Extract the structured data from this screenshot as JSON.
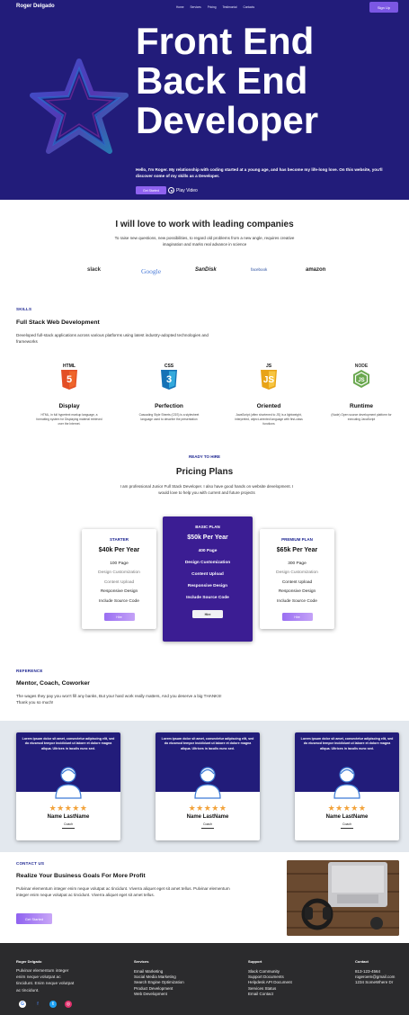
{
  "nav": {
    "brand": "Roger Delgado",
    "links": [
      "Home",
      "Services",
      "Pricing",
      "Testimonial",
      "Contacts"
    ],
    "signup": "Sign Up"
  },
  "hero": {
    "title_line1": "Front End",
    "title_line2": "Back End",
    "title_line3": "Developer",
    "description": "Hello, I'm Roger. My relationship with coding started at a young age, and has become my life-long love. On this website, you'll discover some of my skills as a Developer.",
    "cta": "Get Started",
    "play": "Play Video"
  },
  "companies": {
    "title": "I will love to work with leading companies",
    "description": "To raise new questions, new possibilities, to regard old problems from a new angle, requires creative imagination and marks real advance in science",
    "logos": [
      "slack",
      "Google",
      "SanDisk",
      "facebook",
      "amazon"
    ]
  },
  "skills": {
    "eyebrow": "SKILLS",
    "title": "Full Stack Web Development",
    "description": "Developed full-stack applications across various platforms using latest industry-adopted technologies and frameworks",
    "items": [
      {
        "name": "Display",
        "badge": "HTML",
        "desc": "HTML, in full hypertext markup language, a formatting system for Displaying material retrieved over the Internet."
      },
      {
        "name": "Perfection",
        "badge": "CSS",
        "desc": "Cascading Style Sheets (CSS) is a stylesheet language used to describe the presentation"
      },
      {
        "name": "Oriented",
        "badge": "JS",
        "desc": "JavaScript (often shortened to JS) is a lightweight, interpreted, object-oriented language with first-class functions"
      },
      {
        "name": "Runtime",
        "badge": "NODE",
        "desc": "(Node) Open source development platform for executing JavaScript"
      }
    ]
  },
  "pricing": {
    "eyebrow": "READY TO HIRE",
    "title": "Pricing Plans",
    "description": "I am professional Junior Full Stack Developer. I also have good hands on website development. I would love to help you with current and future projects",
    "plans": [
      {
        "name": "STARTER",
        "price": "$40k Per Year",
        "features": [
          "100 Page",
          "Design Customization",
          "Content Upload",
          "Responsive Design",
          "Include Source Code"
        ],
        "button": "Hire"
      },
      {
        "name": "BASIC PLAN",
        "price": "$50k Per Year",
        "features": [
          "400 Page",
          "Design Customization",
          "Content Upload",
          "Responsive Design",
          "Include Source Code"
        ],
        "button": "Hire"
      },
      {
        "name": "PREMIUM PLAN",
        "price": "$65k Per Year",
        "features": [
          "300 Page",
          "Design Customization",
          "Content Upload",
          "Responsive Design",
          "Include Source Code"
        ],
        "button": "Hire"
      }
    ]
  },
  "reference": {
    "eyebrow": "REFERENCE",
    "title": "Mentor, Coach, Coworker",
    "description": "The wages they pay you won't fill any banks, But your hard work really matters, And you deserve a big THANKS! Thank you so much!",
    "cards": [
      {
        "quote": "Lorem ipsum dolor sit amet, consectetur adipiscing elit, sed do eiusmod tempor incididunt ut labore et dolore magna aliqua. Ultrices in iaculis nunc sed.",
        "stars": "★★★★★",
        "name": "Name LastName",
        "role": "Coach"
      },
      {
        "quote": "Lorem ipsum dolor sit amet, consectetur adipiscing elit, sed do eiusmod tempor incididunt ut labore et dolore magna aliqua. Ultrices in iaculis nunc sed.",
        "stars": "★★★★★",
        "name": "Name LastName",
        "role": "Coach"
      },
      {
        "quote": "Lorem ipsum dolor sit amet, consectetur adipiscing elit, sed do eiusmod tempor incididunt ut labore et dolore magna aliqua. Ultrices in iaculis nunc sed.",
        "stars": "★★★★★",
        "name": "Name LastName",
        "role": "Coach"
      }
    ],
    "rating": 5
  },
  "contact": {
    "eyebrow": "CONTACT US",
    "title": "Realize Your Business Goals For More Profit",
    "description": "Pulvinar elementum integer enim neque volutpat ac tincidunt. Viverra aliquet eget sit amet tellus. Pulvinar elementum integer enim neque volutpat ac tincidunt. Viverra aliquet eget sit amet tellus.",
    "cta": "Get Started"
  },
  "footer": {
    "brand": "Roger Delgado",
    "description": "Pulvinar elementum integer enim neque volutpat ac tincidunt. Enim neque volutpat ac tincidunt.",
    "socials": [
      "google-icon",
      "facebook-icon",
      "twitter-icon",
      "instagram-icon"
    ],
    "services": {
      "title": "Services",
      "items": [
        "Email Marketing",
        "Social Media Marketing",
        "Search Engine Optimization",
        "Product Development",
        "Web Development"
      ]
    },
    "support": {
      "title": "Support",
      "items": [
        "Slack Community",
        "Support Documents",
        "Helpdesk API Document",
        "Services Status",
        "Email Contact"
      ]
    },
    "contact": {
      "title": "Contact",
      "items": [
        "813-123-4564",
        "rogeroem@gmail.com",
        "1234 SomeWhere Dr"
      ]
    }
  },
  "colors": {
    "hero_bg": "#221c7a",
    "accent": "#8f62f0",
    "eyebrow": "#1c2591",
    "featured_plan": "#3b1d93",
    "footer_bg": "#2b2b2d",
    "star": "#f2a23a"
  }
}
